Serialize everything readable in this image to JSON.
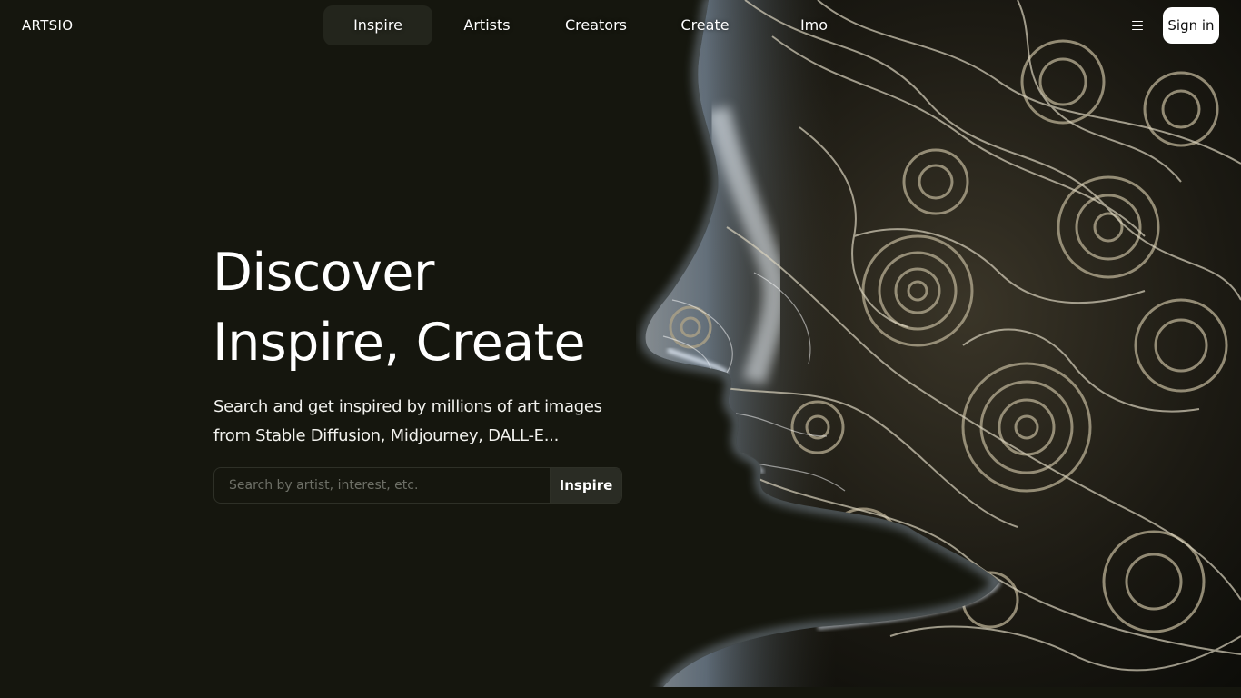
{
  "brand": {
    "logo": "ARTSIO"
  },
  "nav": {
    "items": [
      {
        "label": "Inspire",
        "active": true
      },
      {
        "label": "Artists",
        "active": false
      },
      {
        "label": "Creators",
        "active": false
      },
      {
        "label": "Create",
        "active": false
      },
      {
        "label": "Imo",
        "active": false
      }
    ],
    "menu_icon": "hamburger-icon",
    "signin_label": "Sign in"
  },
  "hero": {
    "title_line1": "Discover",
    "title_line2": "Inspire, Create",
    "subtitle_line1": "Search and get inspired by millions of art images",
    "subtitle_line2": "from Stable Diffusion, Midjourney, DALL-E...",
    "search_placeholder": "Search by artist, interest, etc.",
    "search_value": "",
    "search_button": "Inspire"
  },
  "colors": {
    "background": "#15160e",
    "active_nav": "#23251c",
    "signin_bg": "#ffffff",
    "text": "#ffffff"
  }
}
